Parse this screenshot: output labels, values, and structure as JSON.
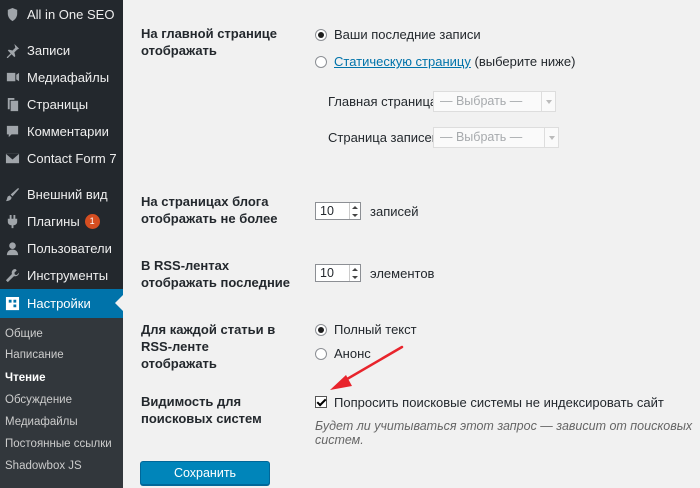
{
  "sidebar": {
    "items": [
      {
        "label": "All in One SEO",
        "icon": "seo-icon"
      },
      {
        "label": "Записи",
        "icon": "pin-icon"
      },
      {
        "label": "Медиафайлы",
        "icon": "media-icon"
      },
      {
        "label": "Страницы",
        "icon": "pages-icon"
      },
      {
        "label": "Комментарии",
        "icon": "comment-icon"
      },
      {
        "label": "Contact Form 7",
        "icon": "mail-icon"
      },
      {
        "label": "Внешний вид",
        "icon": "brush-icon"
      },
      {
        "label": "Плагины",
        "icon": "plugin-icon",
        "badge": "1"
      },
      {
        "label": "Пользователи",
        "icon": "users-icon"
      },
      {
        "label": "Инструменты",
        "icon": "wrench-icon"
      },
      {
        "label": "Настройки",
        "icon": "settings-icon",
        "active": true
      }
    ],
    "submenu": [
      {
        "label": "Общие"
      },
      {
        "label": "Написание"
      },
      {
        "label": "Чтение",
        "current": true
      },
      {
        "label": "Обсуждение"
      },
      {
        "label": "Медиафайлы"
      },
      {
        "label": "Постоянные ссылки"
      },
      {
        "label": "Shadowbox JS"
      }
    ]
  },
  "reading": {
    "front_page": {
      "label": "На главной странице отображать",
      "option_latest": "Ваши последние записи",
      "option_static_link": "Статическую страницу",
      "option_static_suffix": "(выберите ниже)",
      "front_label": "Главная страница:",
      "posts_label": "Страница записей:",
      "select_placeholder": "— Выбрать —"
    },
    "posts_per_page": {
      "label": "На страницах блога отображать не более",
      "value": "10",
      "unit": "записей"
    },
    "rss_items": {
      "label": "В RSS-лентах отображать последние",
      "value": "10",
      "unit": "элементов"
    },
    "rss_content": {
      "label": "Для каждой статьи в RSS-ленте отображать",
      "option_full": "Полный текст",
      "option_summary": "Анонс"
    },
    "visibility": {
      "label": "Видимость для поисковых систем",
      "checkbox_label": "Попросить поисковые системы не индексировать сайт",
      "description": "Будет ли учитываться этот запрос — зависит от поисковых систем."
    },
    "save_label": "Сохранить изменения"
  },
  "colors": {
    "sidebar_bg": "#23282d",
    "submenu_bg": "#32373c",
    "active": "#0073aa",
    "button": "#0085ba",
    "annotation_arrow": "#e8242c"
  }
}
